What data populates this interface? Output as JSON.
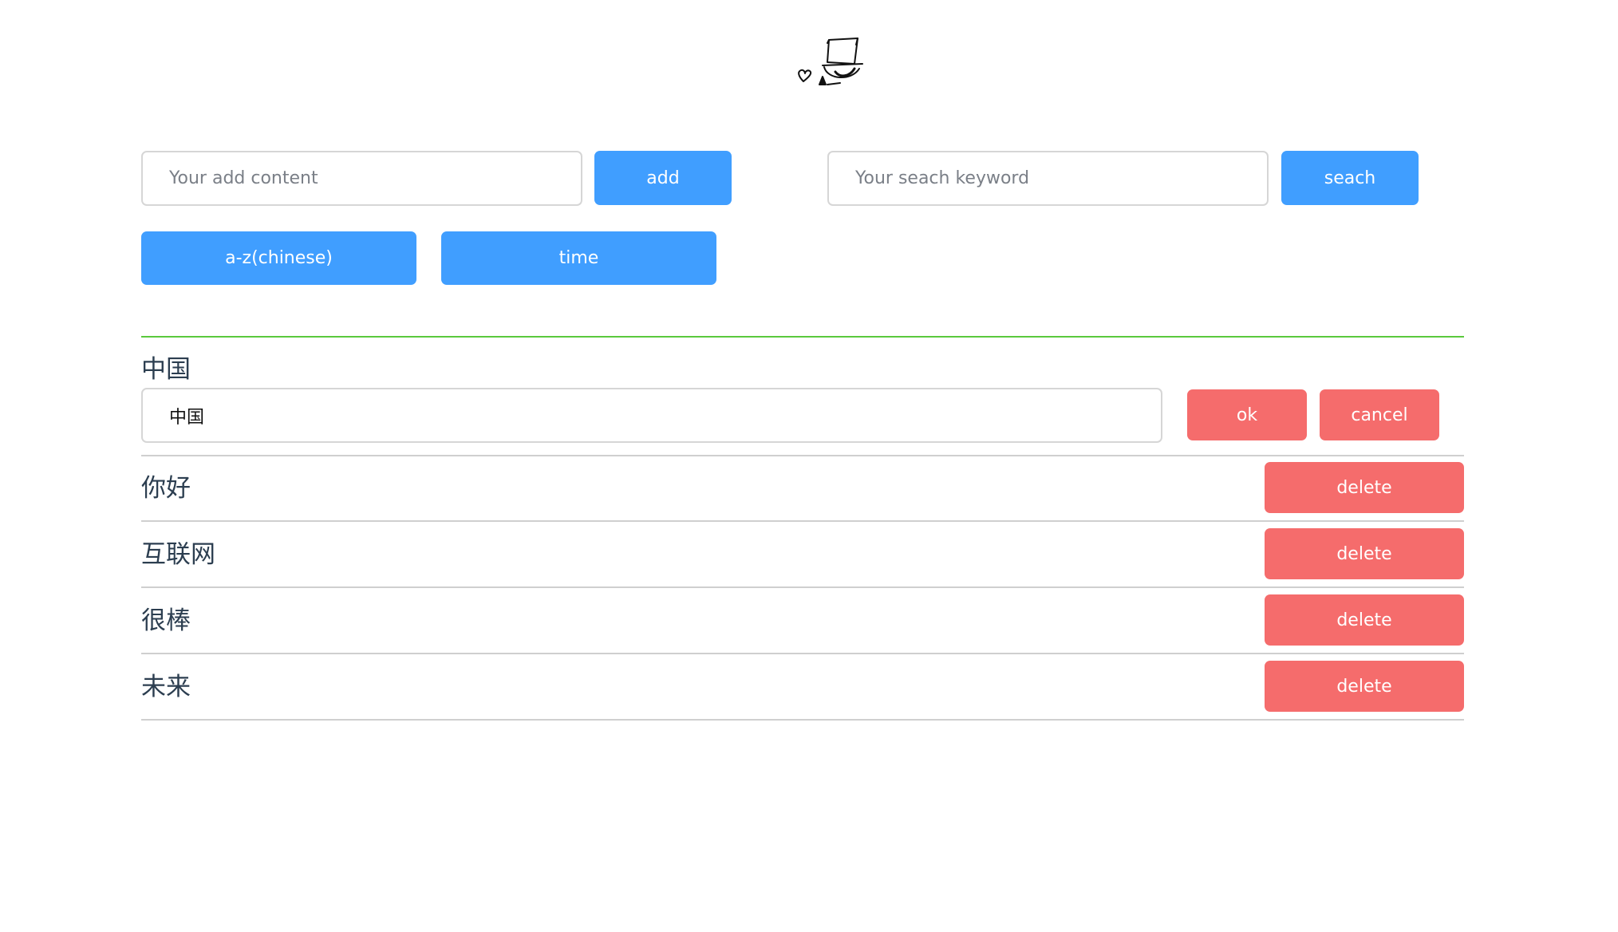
{
  "logo": {
    "icon": "detective-hat-logo-icon"
  },
  "add_form": {
    "placeholder": "Your add content",
    "value": "",
    "button_label": "add"
  },
  "search_form": {
    "placeholder": "Your seach keyword",
    "value": "",
    "button_label": "seach"
  },
  "sort": {
    "alpha_label": "a-z(chinese)",
    "time_label": "time"
  },
  "editing": {
    "label": "中国",
    "value": "中国",
    "ok_label": "ok",
    "cancel_label": "cancel"
  },
  "items": [
    {
      "text": "你好",
      "delete_label": "delete"
    },
    {
      "text": "互联网",
      "delete_label": "delete"
    },
    {
      "text": "很棒",
      "delete_label": "delete"
    },
    {
      "text": "未来",
      "delete_label": "delete"
    }
  ],
  "colors": {
    "primary": "#409eff",
    "danger": "#f56c6c",
    "divider_accent": "#5ac93c"
  }
}
